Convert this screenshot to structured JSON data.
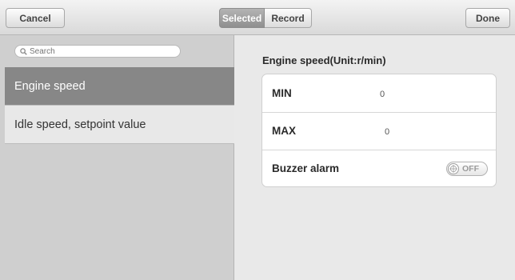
{
  "toolbar": {
    "cancel_label": "Cancel",
    "done_label": "Done",
    "segments": {
      "selected_label": "Selected",
      "record_label": "Record",
      "active": "Selected"
    }
  },
  "sidebar": {
    "search": {
      "placeholder": "Search",
      "value": ""
    },
    "items": [
      {
        "label": "Engine speed",
        "selected": true
      },
      {
        "label": "Idle speed, setpoint value",
        "selected": false
      }
    ]
  },
  "detail": {
    "title": "Engine speed(Unit:r/min)",
    "rows": [
      {
        "label": "MIN",
        "value": "0"
      },
      {
        "label": "MAX",
        "value": "0"
      },
      {
        "label": "Buzzer alarm",
        "toggle_text": "OFF",
        "toggle_state": "off"
      }
    ]
  },
  "icons": {
    "search": "search-icon",
    "toggle_knob": "crosshair-icon"
  },
  "colors": {
    "selected_item_bg": "#878787",
    "sidebar_bg": "#cfcfcf",
    "content_bg": "#e9e9e9"
  }
}
